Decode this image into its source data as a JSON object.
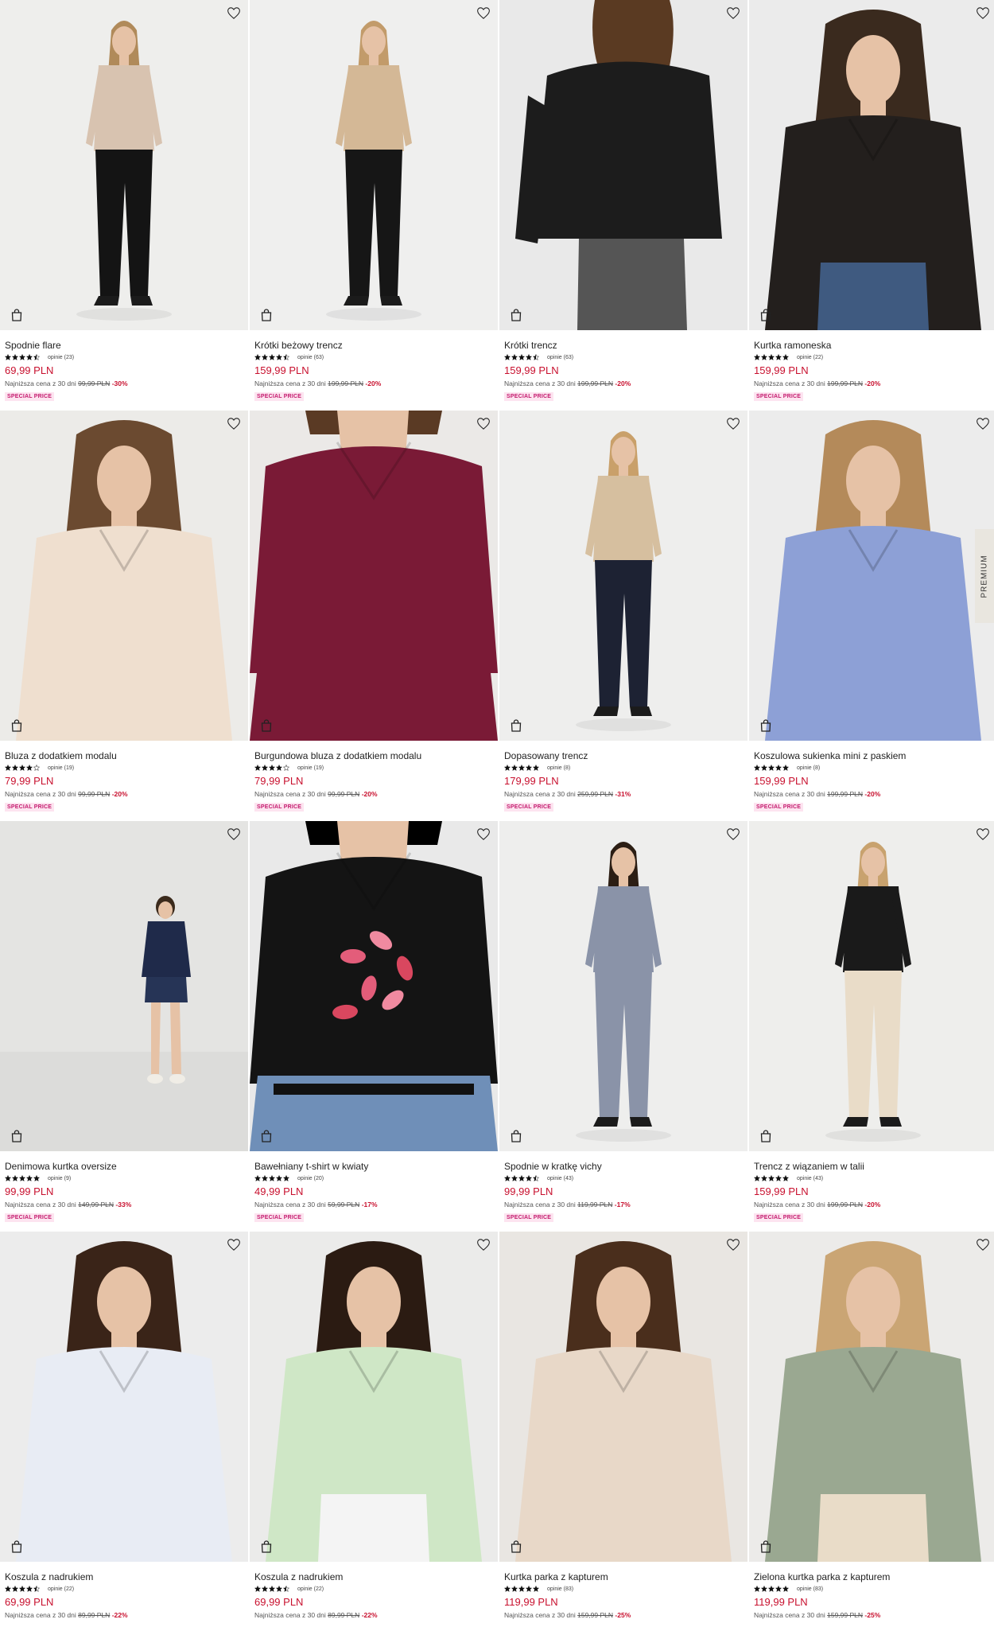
{
  "colors": {
    "price": "#c8102e",
    "badge_bg": "#fde4f0",
    "badge_text": "#c41b6e",
    "star": "#111111"
  },
  "side_tab": {
    "label": "PREMIUM"
  },
  "products": [
    {
      "name": "Spodnie flare",
      "rating": 4.5,
      "reviews": "opinie (23)",
      "price": "69,99 PLN",
      "lowest_label": "Najniższa cena z 30 dni",
      "old_price": "99,99 PLN",
      "discount": "-30%",
      "badge": "SPECIAL PRICE",
      "bg": "#eeeeec",
      "top": "#d8c3b0",
      "bottom": "#141414",
      "hair": "#b08a5a",
      "pose": "standing"
    },
    {
      "name": "Krótki beżowy trencz",
      "rating": 4.5,
      "reviews": "opinie (63)",
      "price": "159,99 PLN",
      "lowest_label": "Najniższa cena z 30 dni",
      "old_price": "199,99 PLN",
      "discount": "-20%",
      "badge": "SPECIAL PRICE",
      "bg": "#efefee",
      "top": "#d4b896",
      "bottom": "#161616",
      "hair": "#c29b6a",
      "pose": "standing"
    },
    {
      "name": "Krótki trencz",
      "rating": 4.5,
      "reviews": "opinie (63)",
      "price": "159,99 PLN",
      "lowest_label": "Najniższa cena z 30 dni",
      "old_price": "199,99 PLN",
      "discount": "-20%",
      "badge": "SPECIAL PRICE",
      "bg": "#e9e9e9",
      "top": "#1c1c1c",
      "bottom": "#555555",
      "hair": "#5a3a22",
      "pose": "back"
    },
    {
      "name": "Kurtka ramoneska",
      "rating": 5,
      "reviews": "opinie (22)",
      "price": "159,99 PLN",
      "lowest_label": "Najniższa cena z 30 dni",
      "old_price": "199,99 PLN",
      "discount": "-20%",
      "badge": "SPECIAL PRICE",
      "bg": "#ebebeb",
      "top": "#231f1d",
      "bottom": "#3f5a80",
      "hair": "#3a2a1e",
      "pose": "closeup"
    },
    {
      "name": "Bluza z dodatkiem modalu",
      "rating": 4,
      "reviews": "opinie (19)",
      "price": "79,99 PLN",
      "lowest_label": "Najniższa cena z 30 dni",
      "old_price": "99,99 PLN",
      "discount": "-20%",
      "badge": "SPECIAL PRICE",
      "bg": "#ecebe8",
      "top": "#efdfcf",
      "bottom": "#efdfcf",
      "hair": "#6b4a30",
      "pose": "closeup"
    },
    {
      "name": "Burgundowa bluza z dodatkiem modalu",
      "rating": 4,
      "reviews": "opinie (19)",
      "price": "79,99 PLN",
      "lowest_label": "Najniższa cena z 30 dni",
      "old_price": "99,99 PLN",
      "discount": "-20%",
      "badge": "SPECIAL PRICE",
      "bg": "#ebe9e7",
      "top": "#7a1a36",
      "bottom": "#7a1a36",
      "hair": "#5a3a24",
      "pose": "crop"
    },
    {
      "name": "Dopasowany trencz",
      "rating": 5,
      "reviews": "opinie (8)",
      "price": "179,99 PLN",
      "lowest_label": "Najniższa cena z 30 dni",
      "old_price": "259,99 PLN",
      "discount": "-31%",
      "badge": "SPECIAL PRICE",
      "bg": "#eeeeed",
      "top": "#d6bf9f",
      "bottom": "#1d2233",
      "hair": "#c9a06a",
      "pose": "standing"
    },
    {
      "name": "Koszulowa sukienka mini z paskiem",
      "rating": 5,
      "reviews": "opinie (8)",
      "price": "159,99 PLN",
      "lowest_label": "Najniższa cena z 30 dni",
      "old_price": "199,99 PLN",
      "discount": "-20%",
      "badge": "SPECIAL PRICE",
      "bg": "#ececec",
      "top": "#8da0d6",
      "bottom": "#8da0d6",
      "hair": "#b48a5a",
      "pose": "closeup"
    },
    {
      "name": "Denimowa kurtka oversize",
      "rating": 5,
      "reviews": "opinie (9)",
      "price": "99,99 PLN",
      "lowest_label": "Najniższa cena z 30 dni",
      "old_price": "149,99 PLN",
      "discount": "-33%",
      "badge": "SPECIAL PRICE",
      "bg": "#e4e4e2",
      "top": "#1f2a4a",
      "bottom": "#1f2a4a",
      "hair": "#3b2a1c",
      "pose": "small"
    },
    {
      "name": "Bawełniany t-shirt w kwiaty",
      "rating": 5,
      "reviews": "opinie (20)",
      "price": "49,99 PLN",
      "lowest_label": "Najniższa cena z 30 dni",
      "old_price": "59,99 PLN",
      "discount": "-17%",
      "badge": "SPECIAL PRICE",
      "bg": "#e9e9e9",
      "top": "#141414",
      "bottom": "#6f8fb8",
      "hair": "#000000",
      "pose": "crop"
    },
    {
      "name": "Spodnie w kratkę vichy",
      "rating": 4.5,
      "reviews": "opinie (43)",
      "price": "99,99 PLN",
      "lowest_label": "Najniższa cena z 30 dni",
      "old_price": "119,99 PLN",
      "discount": "-17%",
      "badge": "SPECIAL PRICE",
      "bg": "#eeeeed",
      "top": "#8a93a8",
      "bottom": "#8a93a8",
      "hair": "#2c1e14",
      "pose": "standing"
    },
    {
      "name": "Trencz z wiązaniem w talii",
      "rating": 5,
      "reviews": "opinie (43)",
      "price": "159,99 PLN",
      "lowest_label": "Najniższa cena z 30 dni",
      "old_price": "199,99 PLN",
      "discount": "-20%",
      "badge": "SPECIAL PRICE",
      "bg": "#eeeeec",
      "top": "#1a1a1a",
      "bottom": "#e9dcc8",
      "hair": "#c8a26e",
      "pose": "standing"
    },
    {
      "name": "Koszula z nadrukiem",
      "rating": 4.5,
      "reviews": "opinie (22)",
      "price": "69,99 PLN",
      "lowest_label": "Najniższa cena z 30 dni",
      "old_price": "89,99 PLN",
      "discount": "-22%",
      "badge": "",
      "bg": "#ececec",
      "top": "#e8ecf4",
      "bottom": "#e8ecf4",
      "hair": "#3a2418",
      "pose": "closeup"
    },
    {
      "name": "Koszula z nadrukiem",
      "rating": 4.5,
      "reviews": "opinie (22)",
      "price": "69,99 PLN",
      "lowest_label": "Najniższa cena z 30 dni",
      "old_price": "89,99 PLN",
      "discount": "-22%",
      "badge": "",
      "bg": "#ebebea",
      "top": "#cfe7c6",
      "bottom": "#f4f4f4",
      "hair": "#2b1b12",
      "pose": "closeup"
    },
    {
      "name": "Kurtka parka z kapturem",
      "rating": 5,
      "reviews": "opinie (83)",
      "price": "119,99 PLN",
      "lowest_label": "Najniższa cena z 30 dni",
      "old_price": "159,99 PLN",
      "discount": "-25%",
      "badge": "",
      "bg": "#e9e6e2",
      "top": "#e8d8c8",
      "bottom": "#e8d8c8",
      "hair": "#4a2e1c",
      "pose": "closeup"
    },
    {
      "name": "Zielona kurtka parka z kapturem",
      "rating": 5,
      "reviews": "opinie (83)",
      "price": "119,99 PLN",
      "lowest_label": "Najniższa cena z 30 dni",
      "old_price": "159,99 PLN",
      "discount": "-25%",
      "badge": "",
      "bg": "#ecebe9",
      "top": "#9aa891",
      "bottom": "#e9dcc8",
      "hair": "#caa574",
      "pose": "closeup"
    }
  ]
}
